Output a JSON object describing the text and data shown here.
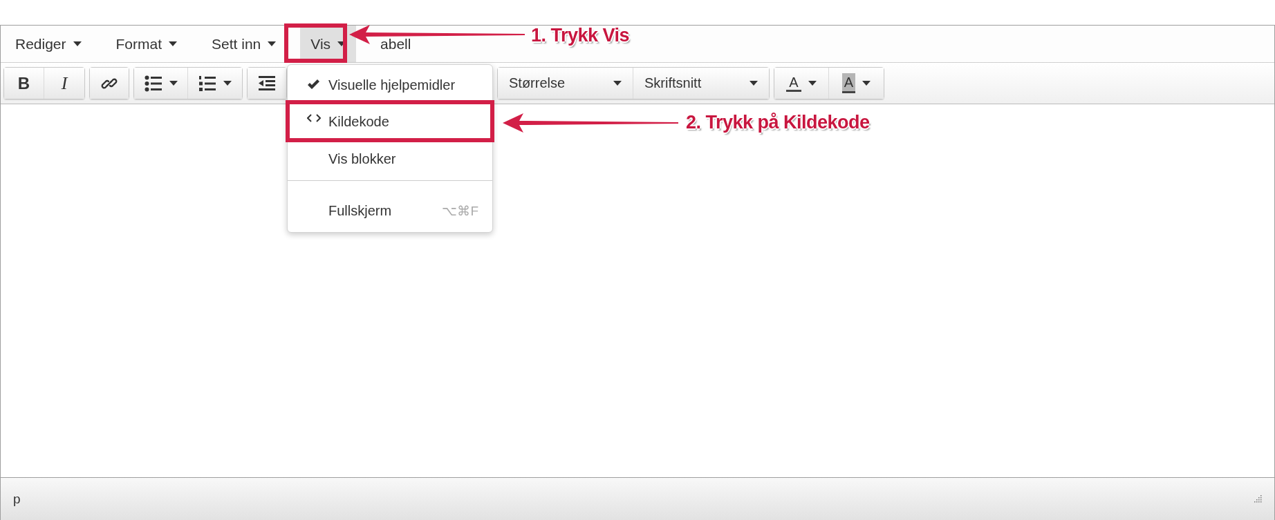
{
  "menubar": [
    {
      "label": "Rediger",
      "caret": true,
      "selected": false
    },
    {
      "label": "Format",
      "caret": true,
      "selected": false
    },
    {
      "label": "Sett inn",
      "caret": true,
      "selected": false
    },
    {
      "label": "Vis",
      "caret": true,
      "selected": true
    },
    {
      "label": "abell",
      "caret": false,
      "selected": false
    }
  ],
  "toolbar": [
    [
      {
        "kind": "bold",
        "label": "B"
      },
      {
        "kind": "italic",
        "label": "I"
      }
    ],
    [
      {
        "kind": "link"
      }
    ],
    [
      {
        "kind": "bullets",
        "caret": true
      },
      {
        "kind": "numbers",
        "caret": true
      }
    ],
    [
      {
        "kind": "outdent"
      }
    ],
    [
      {
        "kind": "select",
        "label": "Størrelse"
      },
      {
        "kind": "select",
        "label": "Skriftsnitt"
      }
    ],
    [
      {
        "kind": "textcolor",
        "label": "A",
        "caret": true
      },
      {
        "kind": "bgcolor",
        "label": "A",
        "caret": true
      }
    ]
  ],
  "view_menu": [
    {
      "kind": "toggle",
      "label": "Visuelle hjelpemidler",
      "checked": true
    },
    {
      "kind": "code",
      "label": "Kildekode"
    },
    {
      "kind": "toggle",
      "label": "Vis blokker",
      "checked": false
    },
    {
      "kind": "separator"
    },
    {
      "kind": "toggle",
      "label": "Fullskjerm",
      "checked": false,
      "shortcut": "⌥⌘F"
    }
  ],
  "status_bar": {
    "path": "p"
  },
  "callouts": [
    {
      "text": "1. Trykk Vis"
    },
    {
      "text": "2. Trykk på Kildekode"
    }
  ]
}
